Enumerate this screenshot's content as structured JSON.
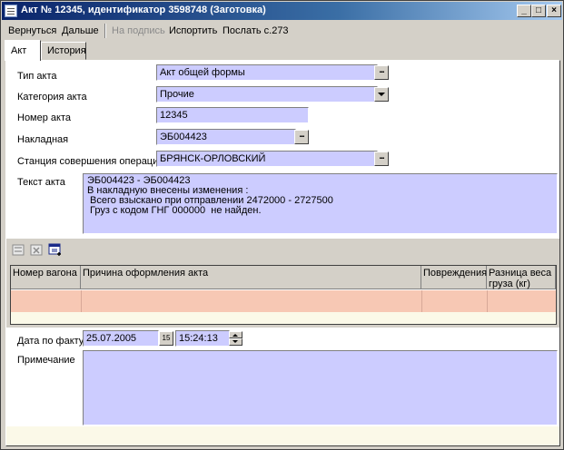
{
  "window": {
    "title": "Акт № 12345, идентификатор 3598748 (Заготовка)",
    "minimize": "_",
    "maximize": "□",
    "close": "×"
  },
  "menu": {
    "back": "Вернуться",
    "next": "Дальше",
    "sign": "На подпись",
    "spoil": "Испортить",
    "send": "Послать с.273"
  },
  "tabs": {
    "act": "Акт",
    "history": "История"
  },
  "form": {
    "act_type_label": "Тип акта",
    "act_type_value": "Акт общей формы",
    "category_label": "Категория акта",
    "category_value": "Прочие",
    "number_label": "Номер акта",
    "number_value": "12345",
    "waybill_label": "Накладная",
    "waybill_value": "ЭБ004423",
    "station_label": "Станция совершения операции",
    "station_value": "БРЯНСК-ОРЛОВСКИЙ",
    "text_label": "Текст акта",
    "text_lines": [
      "ЭБ004423 - ЭБ004423",
      "В накладную внесены изменения :",
      "",
      " Всего взыскано при отправлении 2472000 - 2727500",
      " Груз с кодом ГНГ 000000  не найден."
    ],
    "ellipsis": "..."
  },
  "grid": {
    "columns": [
      "Номер вагона",
      "Причина оформления акта",
      "Повреждения",
      "Разница веса груза (кг)"
    ]
  },
  "actual": {
    "date_label": "Дата по факту",
    "date_value": "25.07.2005",
    "time_value": "15:24:13",
    "calendar_glyph": "15",
    "note_label": "Примечание"
  },
  "colors": {
    "field_bg": "#ccccff",
    "row_highlight": "#f7c8b4",
    "title_gradient_start": "#0a246a"
  }
}
